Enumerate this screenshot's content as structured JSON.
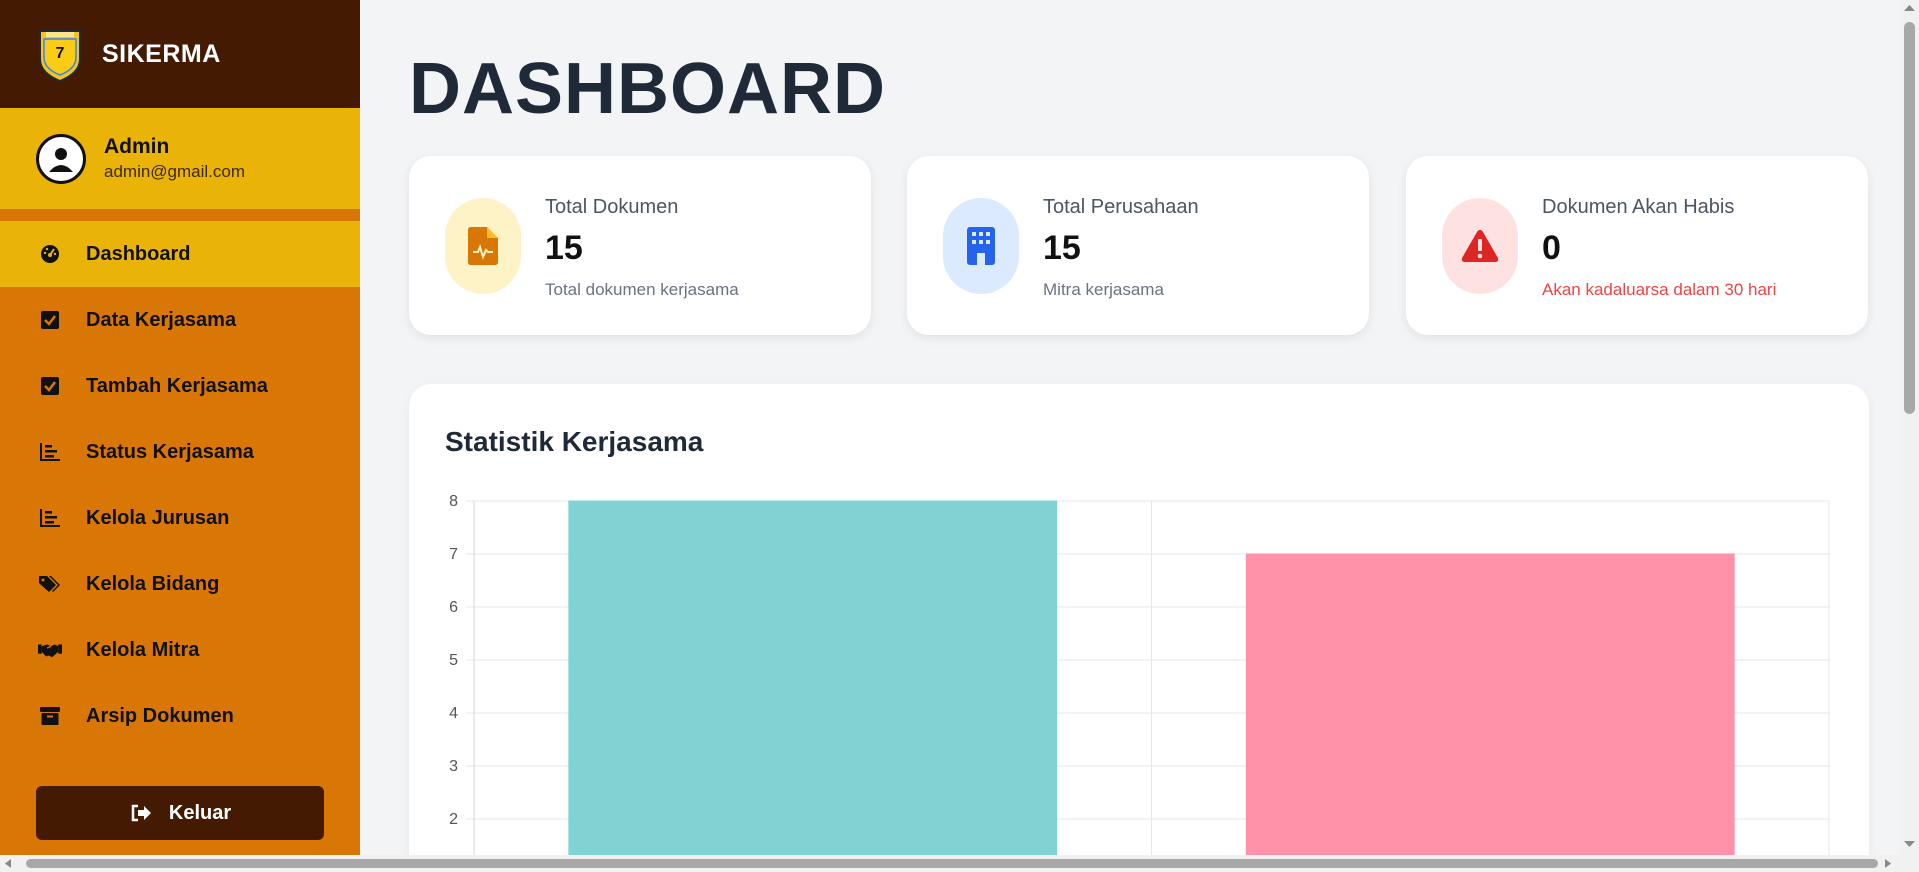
{
  "app": {
    "name": "SIKERMA"
  },
  "user": {
    "name": "Admin",
    "email": "admin@gmail.com"
  },
  "sidebar": {
    "items": [
      {
        "label": "Dashboard",
        "icon": "gauge-icon",
        "active": true
      },
      {
        "label": "Data Kerjasama",
        "icon": "checkbox-icon",
        "active": false
      },
      {
        "label": "Tambah Kerjasama",
        "icon": "checkbox-icon",
        "active": false
      },
      {
        "label": "Status Kerjasama",
        "icon": "bar-list-icon",
        "active": false
      },
      {
        "label": "Kelola Jurusan",
        "icon": "bar-list-icon",
        "active": false
      },
      {
        "label": "Kelola Bidang",
        "icon": "tags-icon",
        "active": false
      },
      {
        "label": "Kelola Mitra",
        "icon": "handshake-icon",
        "active": false
      },
      {
        "label": "Arsip Dokumen",
        "icon": "archive-icon",
        "active": false
      }
    ],
    "logout_label": "Keluar"
  },
  "page": {
    "title": "DASHBOARD"
  },
  "cards": [
    {
      "label": "Total Dokumen",
      "value": "15",
      "sub": "Total dokumen kerjasama",
      "icon": "document-icon",
      "color": "#d97706"
    },
    {
      "label": "Total Perusahaan",
      "value": "15",
      "sub": "Mitra kerjasama",
      "icon": "building-icon",
      "color": "#2563eb"
    },
    {
      "label": "Dokumen Akan Habis",
      "value": "0",
      "sub": "Akan kadaluarsa dalam 30 hari",
      "icon": "warning-icon",
      "color": "#dc2626"
    }
  ],
  "chart_section": {
    "title": "Statistik Kerjasama"
  },
  "chart_data": {
    "type": "bar",
    "categories": [
      "",
      ""
    ],
    "values": [
      8,
      7
    ],
    "colors": [
      "#81d3d3",
      "#ff91a8"
    ],
    "visible_ticks": [
      2,
      3,
      4,
      5,
      6,
      7,
      8
    ],
    "ylim_top": 8,
    "grid": true
  }
}
